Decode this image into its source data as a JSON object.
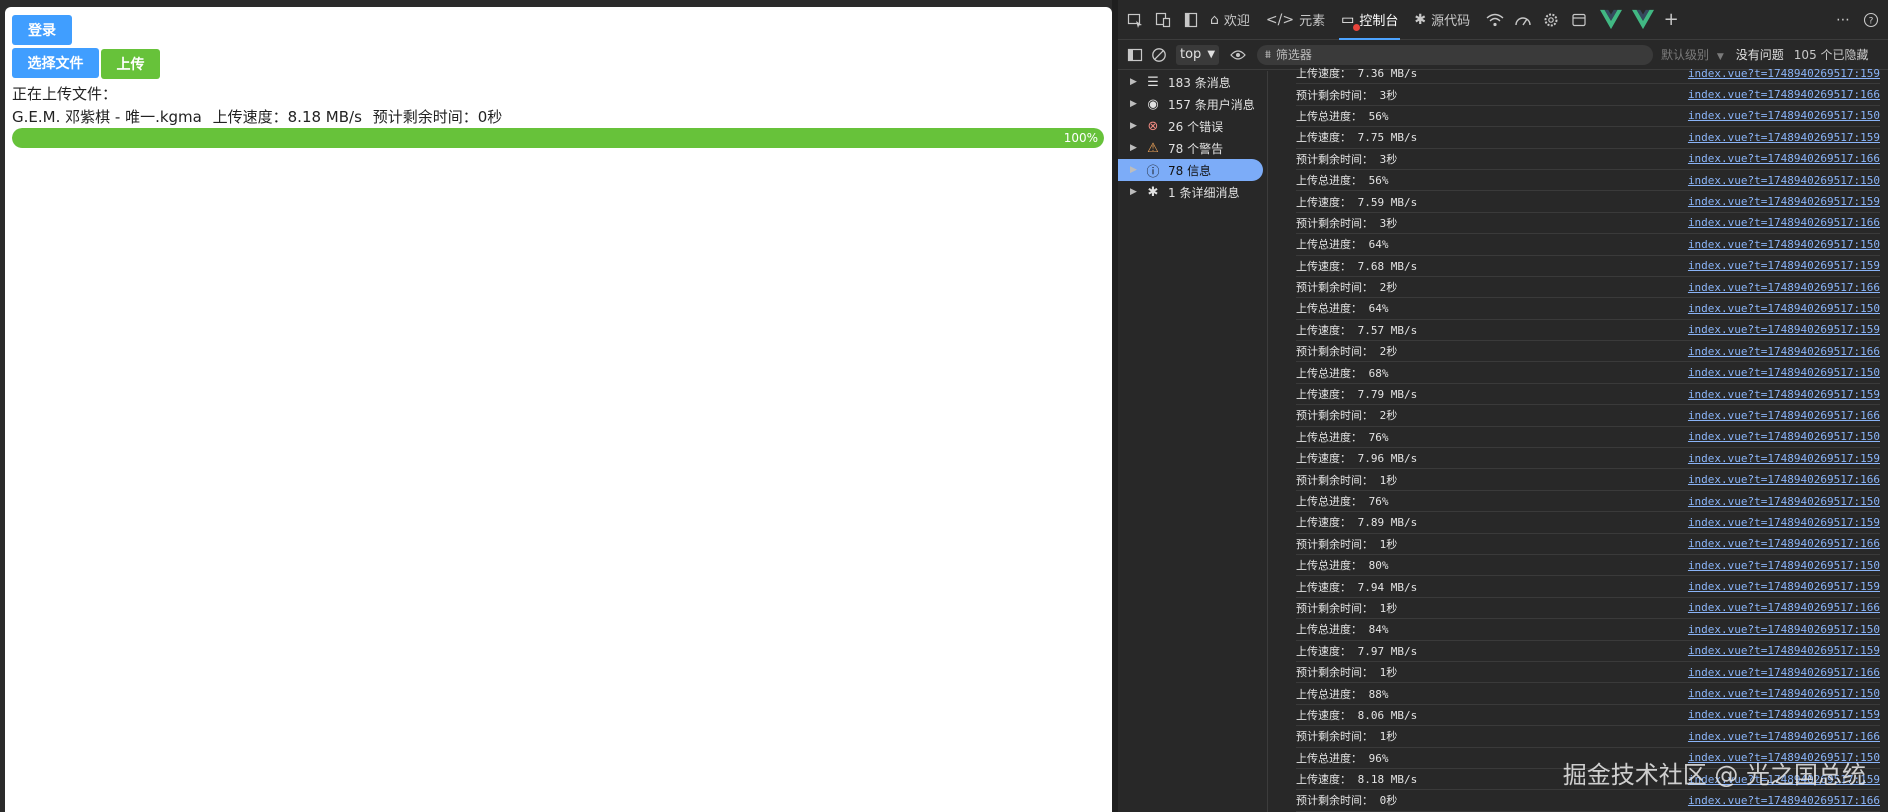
{
  "page": {
    "login_label": "登录",
    "choose_file_label": "选择文件",
    "upload_label": "上传",
    "uploading_label": "正在上传文件：",
    "file_name": "G.E.M. 邓紫棋 - 唯一.kgma",
    "speed_text": "上传速度：8.18 MB/s",
    "eta_text": "预计剩余时间：0秒",
    "progress_percent": 100,
    "progress_text": "100%"
  },
  "colors": {
    "primary": "#409eff",
    "success": "#67c23a",
    "link": "#8ab4f8"
  },
  "devtools": {
    "tabs": [
      {
        "label": "欢迎",
        "icon": "home-icon"
      },
      {
        "label": "元素",
        "icon": "code-icon"
      },
      {
        "label": "控制台",
        "icon": "console-icon",
        "active": true
      },
      {
        "label": "源代码",
        "icon": "bug-icon"
      }
    ],
    "context": "top",
    "filter_placeholder": "筛选器",
    "level": "默认级别",
    "issues": "没有问题",
    "hidden": "105 个已隐藏",
    "sidebar": [
      {
        "count_label": "183 条消息",
        "icon": "list-icon"
      },
      {
        "count_label": "157 条用户消息",
        "icon": "user-icon"
      },
      {
        "count_label": "26 个错误",
        "icon": "error-icon"
      },
      {
        "count_label": "78 个警告",
        "icon": "warning-icon"
      },
      {
        "count_label": "78 信息",
        "icon": "info-icon",
        "selected": true
      },
      {
        "count_label": "1 条详细消息",
        "icon": "bug-icon"
      }
    ],
    "log": [
      {
        "text": "上传速度： 7.36 MB/s",
        "src": "index.vue?t=1748940269517:159"
      },
      {
        "text": "预计剩余时间： 3秒",
        "src": "index.vue?t=1748940269517:166"
      },
      {
        "text": "上传总进度： 56%",
        "src": "index.vue?t=1748940269517:150"
      },
      {
        "text": "上传速度： 7.75 MB/s",
        "src": "index.vue?t=1748940269517:159"
      },
      {
        "text": "预计剩余时间： 3秒",
        "src": "index.vue?t=1748940269517:166"
      },
      {
        "text": "上传总进度： 56%",
        "src": "index.vue?t=1748940269517:150"
      },
      {
        "text": "上传速度： 7.59 MB/s",
        "src": "index.vue?t=1748940269517:159"
      },
      {
        "text": "预计剩余时间： 3秒",
        "src": "index.vue?t=1748940269517:166"
      },
      {
        "text": "上传总进度： 64%",
        "src": "index.vue?t=1748940269517:150"
      },
      {
        "text": "上传速度： 7.68 MB/s",
        "src": "index.vue?t=1748940269517:159"
      },
      {
        "text": "预计剩余时间： 2秒",
        "src": "index.vue?t=1748940269517:166"
      },
      {
        "text": "上传总进度： 64%",
        "src": "index.vue?t=1748940269517:150"
      },
      {
        "text": "上传速度： 7.57 MB/s",
        "src": "index.vue?t=1748940269517:159"
      },
      {
        "text": "预计剩余时间： 2秒",
        "src": "index.vue?t=1748940269517:166"
      },
      {
        "text": "上传总进度： 68%",
        "src": "index.vue?t=1748940269517:150"
      },
      {
        "text": "上传速度： 7.79 MB/s",
        "src": "index.vue?t=1748940269517:159"
      },
      {
        "text": "预计剩余时间： 2秒",
        "src": "index.vue?t=1748940269517:166"
      },
      {
        "text": "上传总进度： 76%",
        "src": "index.vue?t=1748940269517:150"
      },
      {
        "text": "上传速度： 7.96 MB/s",
        "src": "index.vue?t=1748940269517:159"
      },
      {
        "text": "预计剩余时间： 1秒",
        "src": "index.vue?t=1748940269517:166"
      },
      {
        "text": "上传总进度： 76%",
        "src": "index.vue?t=1748940269517:150"
      },
      {
        "text": "上传速度： 7.89 MB/s",
        "src": "index.vue?t=1748940269517:159"
      },
      {
        "text": "预计剩余时间： 1秒",
        "src": "index.vue?t=1748940269517:166"
      },
      {
        "text": "上传总进度： 80%",
        "src": "index.vue?t=1748940269517:150"
      },
      {
        "text": "上传速度： 7.94 MB/s",
        "src": "index.vue?t=1748940269517:159"
      },
      {
        "text": "预计剩余时间： 1秒",
        "src": "index.vue?t=1748940269517:166"
      },
      {
        "text": "上传总进度： 84%",
        "src": "index.vue?t=1748940269517:150"
      },
      {
        "text": "上传速度： 7.97 MB/s",
        "src": "index.vue?t=1748940269517:159"
      },
      {
        "text": "预计剩余时间： 1秒",
        "src": "index.vue?t=1748940269517:166"
      },
      {
        "text": "上传总进度： 88%",
        "src": "index.vue?t=1748940269517:150"
      },
      {
        "text": "上传速度： 8.06 MB/s",
        "src": "index.vue?t=1748940269517:159"
      },
      {
        "text": "预计剩余时间： 1秒",
        "src": "index.vue?t=1748940269517:166"
      },
      {
        "text": "上传总进度： 96%",
        "src": "index.vue?t=1748940269517:150"
      },
      {
        "text": "上传速度： 8.18 MB/s",
        "src": "index.vue?t=1748940269517:159"
      },
      {
        "text": "预计剩余时间： 0秒",
        "src": "index.vue?t=1748940269517:166"
      }
    ]
  },
  "watermark": "掘金技术社区 @ 光之国总统"
}
